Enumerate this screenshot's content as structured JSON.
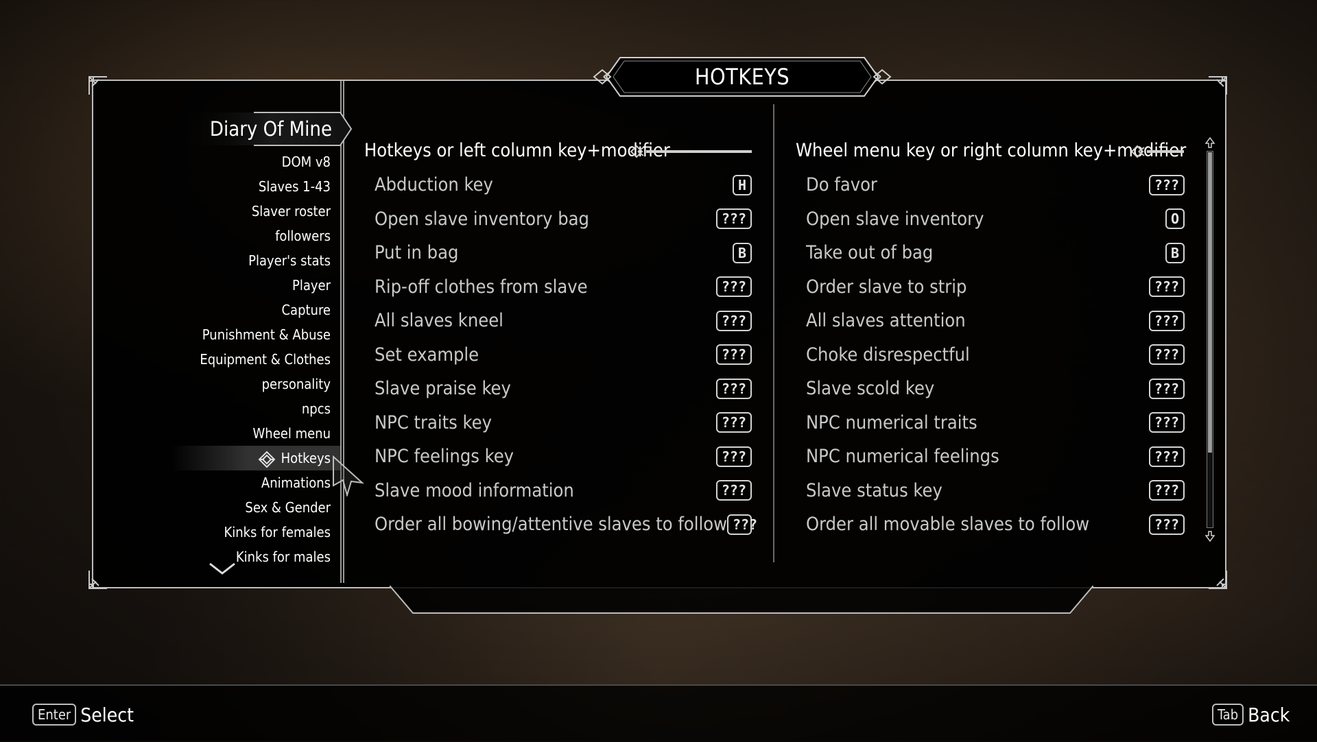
{
  "window": {
    "title": "HOTKEYS"
  },
  "sidebar": {
    "mod_title": "Diary Of Mine",
    "items": [
      {
        "label": "DOM v8"
      },
      {
        "label": "Slaves 1-43"
      },
      {
        "label": "Slaver roster"
      },
      {
        "label": "followers"
      },
      {
        "label": "Player's stats"
      },
      {
        "label": "Player"
      },
      {
        "label": "Capture"
      },
      {
        "label": "Punishment & Abuse"
      },
      {
        "label": "Equipment & Clothes"
      },
      {
        "label": "personality"
      },
      {
        "label": "npcs"
      },
      {
        "label": "Wheel menu"
      },
      {
        "label": "Hotkeys",
        "active": true
      },
      {
        "label": "Animations"
      },
      {
        "label": "Sex & Gender"
      },
      {
        "label": "Kinks for females"
      },
      {
        "label": "Kinks for males"
      }
    ]
  },
  "left_column": {
    "header": "Hotkeys or left column key+modifier",
    "rows": [
      {
        "label": "Abduction key",
        "key": "H"
      },
      {
        "label": "Open slave inventory bag",
        "key": "???"
      },
      {
        "label": "Put in bag",
        "key": "B"
      },
      {
        "label": "Rip-off clothes from slave",
        "key": "???"
      },
      {
        "label": "All slaves kneel",
        "key": "???"
      },
      {
        "label": "Set example",
        "key": "???"
      },
      {
        "label": "Slave praise key",
        "key": "???"
      },
      {
        "label": "NPC traits key",
        "key": "???"
      },
      {
        "label": "NPC feelings key",
        "key": "???"
      },
      {
        "label": "Slave mood information",
        "key": "???"
      },
      {
        "label": "Order all bowing/attentive slaves to follow",
        "key": "???"
      }
    ]
  },
  "right_column": {
    "header": "Wheel menu key or right column key+modifier",
    "rows": [
      {
        "label": "Do favor",
        "key": "???"
      },
      {
        "label": "Open slave inventory",
        "key": "O"
      },
      {
        "label": "Take out of bag",
        "key": "B"
      },
      {
        "label": "Order slave to strip",
        "key": "???"
      },
      {
        "label": "All slaves attention",
        "key": "???"
      },
      {
        "label": "Choke disrespectful",
        "key": "???"
      },
      {
        "label": "Slave scold key",
        "key": "???"
      },
      {
        "label": "NPC numerical traits",
        "key": "???"
      },
      {
        "label": "NPC numerical feelings",
        "key": "???"
      },
      {
        "label": "Slave status key",
        "key": "???"
      },
      {
        "label": "Order all movable slaves to follow",
        "key": "???"
      }
    ]
  },
  "footer": {
    "select": {
      "key": "Enter",
      "label": "Select"
    },
    "back": {
      "key": "Tab",
      "label": "Back"
    }
  },
  "icons": {
    "active_item": "knot-icon",
    "scroll_more": "chevron-down-icon",
    "cursor": "cursor-icon"
  },
  "colors": {
    "panel_bg": "#000000",
    "frame": "#bdbdbd",
    "option_text": "#c9c9c9",
    "text": "#ffffff"
  }
}
